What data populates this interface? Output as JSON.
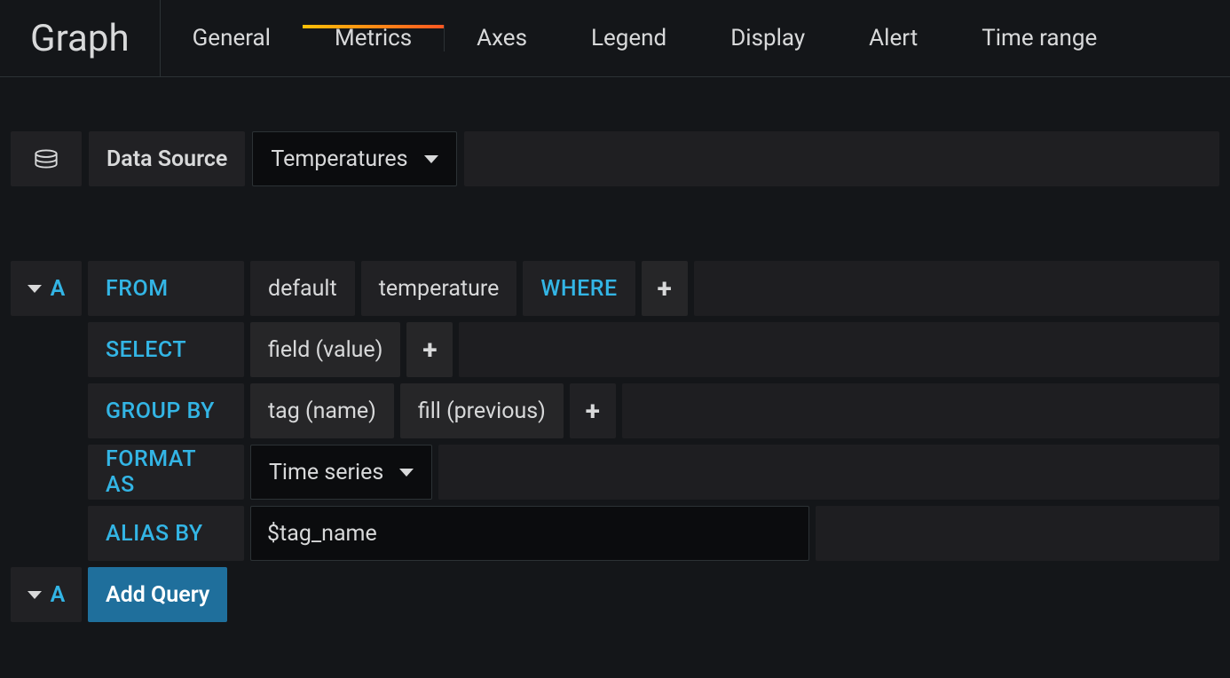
{
  "title": "Graph",
  "tabs": {
    "general": "General",
    "metrics": "Metrics",
    "axes": "Axes",
    "legend": "Legend",
    "display": "Display",
    "alert": "Alert",
    "timerange": "Time range"
  },
  "active_tab": "metrics",
  "datasource": {
    "label": "Data Source",
    "selected": "Temperatures"
  },
  "query": {
    "letter": "A",
    "from": {
      "keyword": "FROM",
      "policy": "default",
      "measurement": "temperature",
      "where": "WHERE"
    },
    "select": {
      "keyword": "SELECT",
      "field": "field (value)"
    },
    "groupby": {
      "keyword": "GROUP BY",
      "tag": "tag (name)",
      "fill": "fill (previous)"
    },
    "formatas": {
      "keyword": "FORMAT AS",
      "value": "Time series"
    },
    "aliasby": {
      "keyword": "ALIAS BY",
      "value": "$tag_name"
    }
  },
  "add_query": {
    "letter": "A",
    "label": "Add Query"
  }
}
